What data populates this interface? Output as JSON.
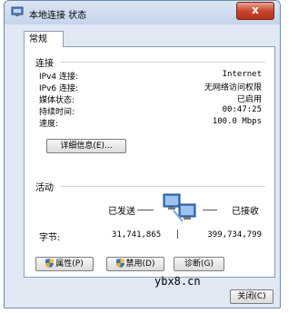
{
  "window": {
    "title": "本地连接 状态",
    "close_label": "x"
  },
  "tabs": [
    {
      "label": "常规"
    }
  ],
  "connection": {
    "group_label": "连接",
    "rows": [
      {
        "label": "IPv4 连接:",
        "value": "Internet"
      },
      {
        "label": "IPv6 连接:",
        "value": "无网络访问权限"
      },
      {
        "label": "媒体状态:",
        "value": "已启用"
      },
      {
        "label": "持续时间:",
        "value": "00:47:25"
      },
      {
        "label": "速度:",
        "value": "100.0 Mbps"
      }
    ],
    "details_button": "详细信息(E)..."
  },
  "activity": {
    "group_label": "活动",
    "sent_label": "已发送",
    "received_label": "已接收",
    "bytes_label": "字节:",
    "bytes_sent": "31,741,865",
    "bytes_received": "399,734,799",
    "icon": "network-computers-icon"
  },
  "buttons": {
    "properties": "属性(P)",
    "disable": "禁用(D)",
    "diagnose": "诊断(G)",
    "close": "关闭(C)"
  },
  "watermark": {
    "site": "ybx8.cn"
  },
  "colors": {
    "window_bg": "#dfe8f3",
    "close_red": "#c7462d",
    "panel_border": "#8c9fb5"
  }
}
